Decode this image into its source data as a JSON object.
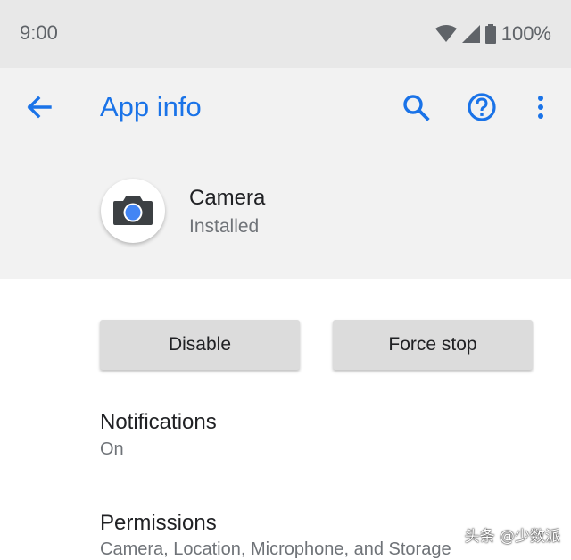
{
  "status_bar": {
    "time": "9:00",
    "battery": "100%",
    "icons": [
      "wifi-icon",
      "cell-signal-icon",
      "battery-icon"
    ]
  },
  "toolbar": {
    "title": "App info",
    "back_icon": "arrow-back-icon",
    "search_icon": "search-icon",
    "help_icon": "help-icon",
    "more_icon": "more-vert-icon",
    "accent_color": "#1a73e8"
  },
  "app": {
    "name": "Camera",
    "status": "Installed",
    "icon": "camera-icon"
  },
  "actions": {
    "disable_label": "Disable",
    "force_stop_label": "Force stop"
  },
  "settings": [
    {
      "title": "Notifications",
      "subtitle": "On"
    },
    {
      "title": "Permissions",
      "subtitle": "Camera, Location, Microphone, and Storage"
    }
  ],
  "watermark": "头条 @少数派"
}
